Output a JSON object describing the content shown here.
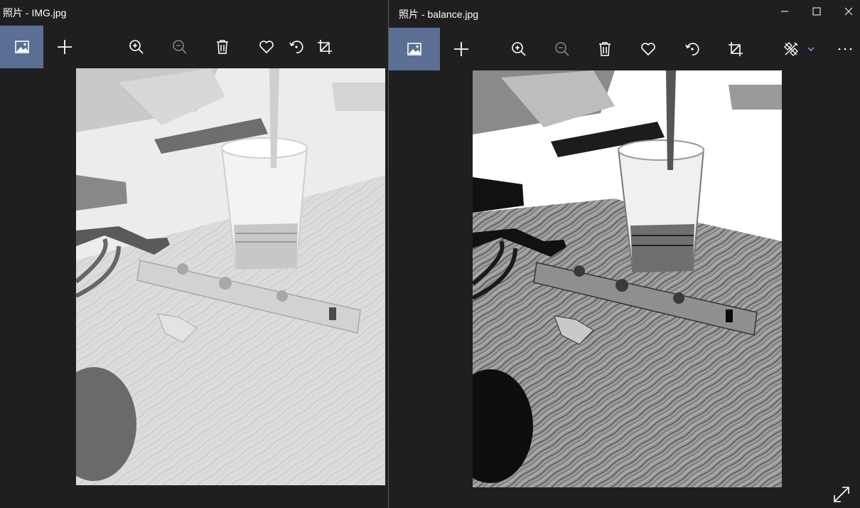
{
  "left_window": {
    "title": "照片 - IMG.jpg",
    "toolbar": [
      "image-gallery-icon",
      "add-icon",
      "zoom-in-icon",
      "zoom-out-icon",
      "delete-icon",
      "favorite-icon",
      "rotate-icon",
      "crop-icon"
    ]
  },
  "right_window": {
    "title": "照片 - balance.jpg",
    "toolbar": [
      "image-gallery-icon",
      "add-icon",
      "zoom-in-icon",
      "zoom-out-icon",
      "delete-icon",
      "favorite-icon",
      "rotate-icon",
      "crop-icon",
      "edit-icon",
      "chevron-down-icon",
      "more-icon"
    ],
    "caption_buttons": [
      "minimize-icon",
      "maximize-icon",
      "close-icon"
    ],
    "corner_button": "expand-icon"
  },
  "colors": {
    "background": "#1f1f1f",
    "accent": "#5b6f95",
    "icon": "#ffffff",
    "edit_chevron": "#7b93c9"
  }
}
